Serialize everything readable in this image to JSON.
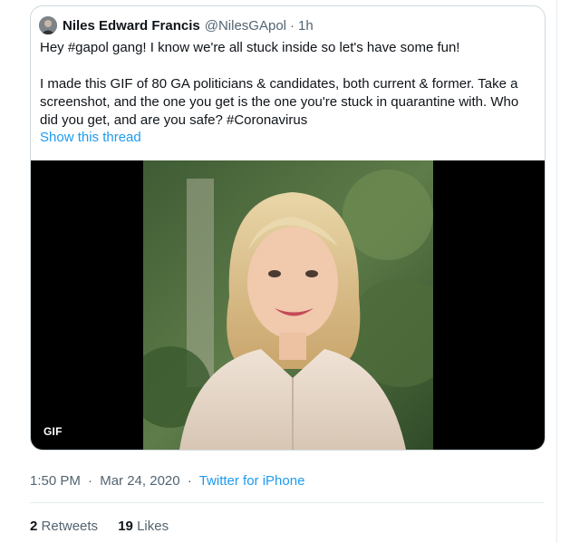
{
  "quoted_tweet": {
    "author_name": "Niles Edward Francis",
    "author_handle": "@NilesGApol",
    "dot": "·",
    "time": "1h",
    "text": "Hey #gapol gang! I know we're all stuck inside so let's have some fun!\n\nI made this GIF of 80 GA politicians & candidates, both current & former. Take a screenshot, and the one you get is the one you're stuck in quarantine with. Who did you get, and are you safe? #Coronavirus",
    "show_thread": "Show this thread",
    "media_badge": "GIF"
  },
  "meta": {
    "time": "1:50 PM",
    "sep1": "·",
    "date": "Mar 24, 2020",
    "sep2": "·",
    "source": "Twitter for iPhone"
  },
  "stats": {
    "retweets_count": "2",
    "retweets_label": "Retweets",
    "likes_count": "19",
    "likes_label": "Likes"
  },
  "colors": {
    "link": "#1d9bf0",
    "muted": "#536471",
    "border": "#cfd9de"
  }
}
